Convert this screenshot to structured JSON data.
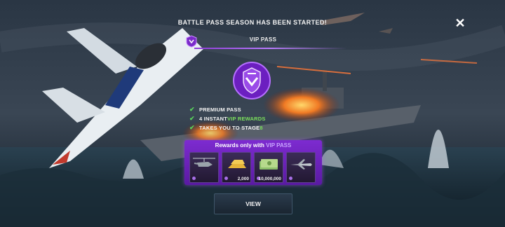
{
  "banner": {
    "title": "BATTLE PASS SEASON HAS BEEN STARTED!"
  },
  "pass": {
    "label": "VIP PASS",
    "badge_icon": "vip-badge-icon",
    "emblem_icon": "vip-pass-emblem-icon"
  },
  "features": [
    {
      "text": "PREMIUM PASS"
    },
    {
      "prefix": "4 INSTANT ",
      "highlight": "VIP REWARDS"
    },
    {
      "prefix": "TAKES YOU TO STAGE ",
      "highlight": "8"
    }
  ],
  "rewards": {
    "title_prefix": "Rewards only with ",
    "title_highlight": "VIP PASS",
    "items": [
      {
        "icon": "helicopter-icon",
        "amount": ""
      },
      {
        "icon": "gold-bars-icon",
        "amount": "2,000"
      },
      {
        "icon": "cash-icon",
        "amount": "10,000,000"
      },
      {
        "icon": "jet-fighter-icon",
        "amount": ""
      }
    ]
  },
  "buttons": {
    "view": "VIEW",
    "close": "✕"
  },
  "colors": {
    "accent_purple": "#8d3bd6",
    "check_green": "#59d45a",
    "highlight_green": "#7be05c"
  }
}
